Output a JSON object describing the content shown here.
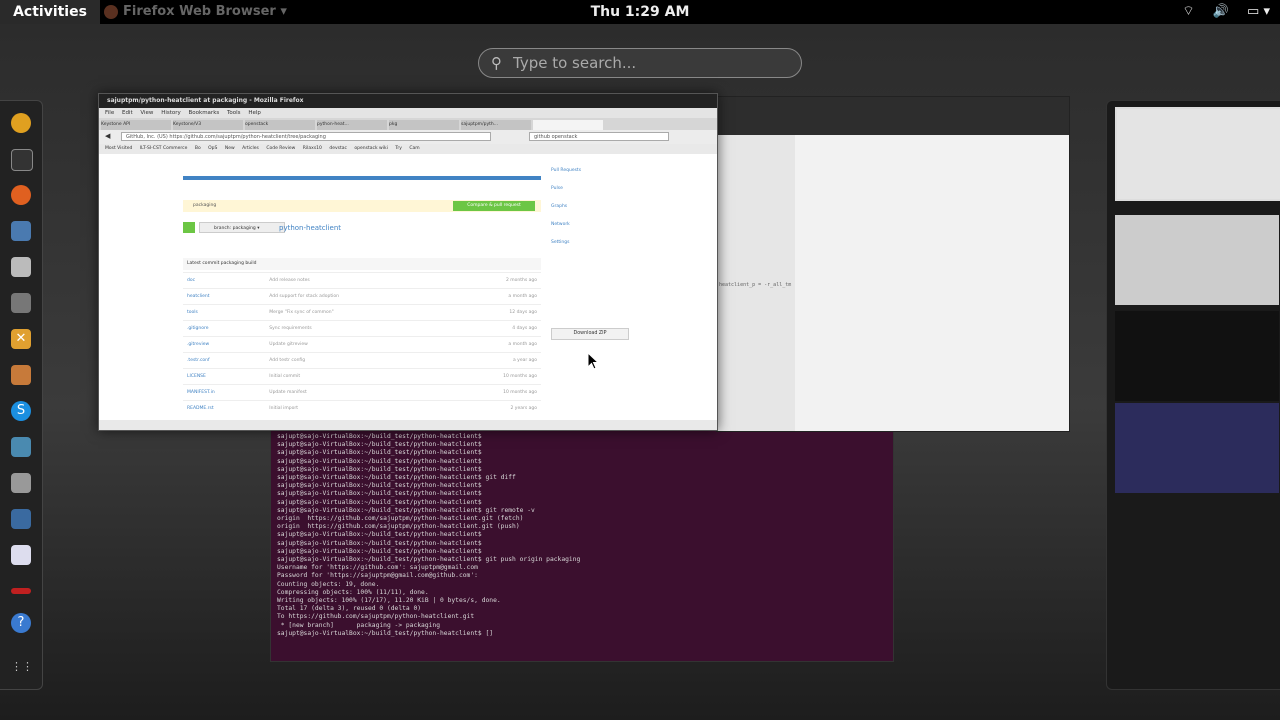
{
  "topbar": {
    "activities_label": "Activities",
    "app_menu_label": "Firefox Web Browser ▾",
    "clock": "Thu  1:29 AM",
    "status_icons": [
      "wifi-icon",
      "volume-icon",
      "battery-icon"
    ]
  },
  "search": {
    "placeholder": "Type to search..."
  },
  "dash": {
    "items": [
      "chromium",
      "terminal",
      "firefox",
      "image-viewer",
      "files",
      "software-center",
      "settings",
      "calendar",
      "skype",
      "chat",
      "usb",
      "notes",
      "document",
      "red-app",
      "help",
      "show-apps"
    ]
  },
  "firefox": {
    "title": "sajuptpm/python-heatclient at packaging - Mozilla Firefox",
    "menu": [
      "File",
      "Edit",
      "View",
      "History",
      "Bookmarks",
      "Tools",
      "Help"
    ],
    "tabs": [
      "Keystone API",
      "Keystone/V3",
      "openstack",
      "python-heat...",
      "pkg",
      "sajuptpm/pyth..."
    ],
    "url": "GitHub, Inc. (US)   https://github.com/sajuptpm/python-heatclient/tree/packaging",
    "search_text": "github openstack",
    "bookmarks": [
      "Most Visited",
      "ILT-SI-CST Commerce",
      "Bo",
      "OpS",
      "New",
      "Articles",
      "Code Review",
      "Rilaxs10",
      "devstac",
      "openstack wiki",
      "Try",
      "Cam"
    ],
    "page": {
      "compare_label": "Compare & pull request",
      "branch_notice": "packaging",
      "branch_select": "branch: packaging ▾",
      "repo_name": "python-heatclient",
      "latest_commit": "Latest commit packaging build",
      "files": [
        {
          "name": "doc",
          "msg": "Add release notes",
          "age": "2 months ago"
        },
        {
          "name": "heatclient",
          "msg": "Add support for stack adoption",
          "age": "a month ago"
        },
        {
          "name": "tools",
          "msg": "Merge \"Fix sync of common\"",
          "age": "12 days ago"
        },
        {
          "name": ".gitignore",
          "msg": "Sync requirements",
          "age": "4 days ago"
        },
        {
          "name": ".gitreview",
          "msg": "Update gitreview",
          "age": "a month ago"
        },
        {
          "name": ".testr.conf",
          "msg": "Add testr config",
          "age": "a year ago"
        },
        {
          "name": "LICENSE",
          "msg": "Initial commit",
          "age": "10 months ago"
        },
        {
          "name": "MANIFEST.in",
          "msg": "Update manifest",
          "age": "10 months ago"
        },
        {
          "name": "README.rst",
          "msg": "Initial import",
          "age": "2 years ago"
        }
      ],
      "sidebar": [
        "Pull Requests",
        "Pulse",
        "Graphs",
        "Network",
        "Settings"
      ],
      "download_zip": "Download ZIP"
    }
  },
  "terminal": {
    "lines": [
      "sajupt@sajo-VirtualBox:~/build_test/python-heatclient$",
      "sajupt@sajo-VirtualBox:~/build_test/python-heatclient$",
      "sajupt@sajo-VirtualBox:~/build_test/python-heatclient$",
      "sajupt@sajo-VirtualBox:~/build_test/python-heatclient$",
      "sajupt@sajo-VirtualBox:~/build_test/python-heatclient$",
      "sajupt@sajo-VirtualBox:~/build_test/python-heatclient$ git diff",
      "sajupt@sajo-VirtualBox:~/build_test/python-heatclient$",
      "sajupt@sajo-VirtualBox:~/build_test/python-heatclient$",
      "sajupt@sajo-VirtualBox:~/build_test/python-heatclient$",
      "sajupt@sajo-VirtualBox:~/build_test/python-heatclient$ git remote -v",
      "origin  https://github.com/sajuptpm/python-heatclient.git (fetch)",
      "origin  https://github.com/sajuptpm/python-heatclient.git (push)",
      "sajupt@sajo-VirtualBox:~/build_test/python-heatclient$",
      "sajupt@sajo-VirtualBox:~/build_test/python-heatclient$",
      "sajupt@sajo-VirtualBox:~/build_test/python-heatclient$",
      "sajupt@sajo-VirtualBox:~/build_test/python-heatclient$ git push origin packaging",
      "Username for 'https://github.com': sajuptpm@gmail.com",
      "Password for 'https://sajuptpm@gmail.com@github.com':",
      "Counting objects: 19, done.",
      "Compressing objects: 100% (11/11), done.",
      "Writing objects: 100% (17/17), 11.20 KiB | 0 bytes/s, done.",
      "Total 17 (delta 3), reused 0 (delta 0)",
      "To https://github.com/sajuptpm/python-heatclient.git",
      " * [new branch]      packaging -> packaging",
      "sajupt@sajo-VirtualBox:~/build_test/python-heatclient$ []"
    ]
  },
  "editor": {
    "code_line": "heatclient_p = -r_all_tm"
  }
}
